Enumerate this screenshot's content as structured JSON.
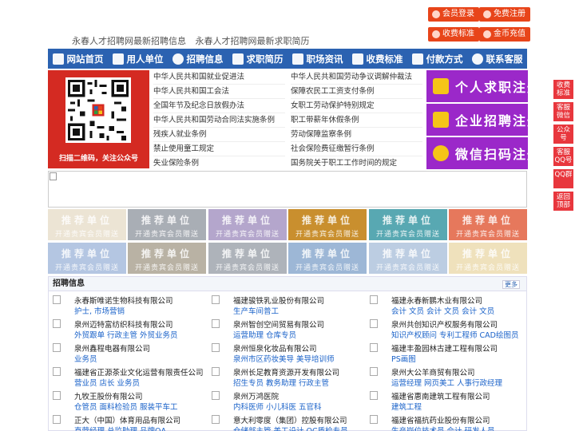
{
  "top_buttons": {
    "member_login": "会员登录",
    "free_register": "免费注册",
    "fee_standard": "收费标准",
    "coin_recharge": "金币充值"
  },
  "subtitle": {
    "item1": "永春人才招聘网最新招聘信息",
    "item2": "永春人才招聘网最新求职简历"
  },
  "nav": {
    "items": [
      {
        "label": "网站首页",
        "icon": "home-icon"
      },
      {
        "label": "用人单位",
        "icon": "building-icon"
      },
      {
        "label": "招聘信息",
        "icon": "chat-icon"
      },
      {
        "label": "求职简历",
        "icon": "id-card-icon"
      },
      {
        "label": "职场资讯",
        "icon": "news-icon"
      },
      {
        "label": "收费标准",
        "icon": "coin-icon"
      },
      {
        "label": "付款方式",
        "icon": "card-icon"
      },
      {
        "label": "联系客服",
        "icon": "phone-icon"
      }
    ]
  },
  "qr": {
    "caption": "扫描二维码，关注公众号"
  },
  "laws": {
    "left": [
      "中华人民共和国就业促进法",
      "中华人民共和国工会法",
      "全国年节及纪念日放假办法",
      "中华人民共和国劳动合同法实施条例",
      "残疾人就业条例",
      "禁止使用童工规定",
      "失业保险条例"
    ],
    "right": [
      "中华人民共和国劳动争议调解仲裁法",
      "保障农民工工资支付条例",
      "女职工劳动保护特别规定",
      "职工带薪年休假条例",
      "劳动保障监察条例",
      "社会保险费征缴暂行条例",
      "国务院关于职工工作时间的规定"
    ]
  },
  "register": {
    "personal": "个人求职注册",
    "company": "企业招聘注册",
    "wechat": "微信扫码注册"
  },
  "recommend": {
    "title": "推荐单位",
    "sub": "开通贵宾会员赠送",
    "colors": [
      "#ece4d4",
      "#a9aeb5",
      "#b4a6cc",
      "#c98f2e",
      "#58a8b2",
      "#e6785c",
      "#b4c6e2",
      "#b9b2a4",
      "#aeb3ba",
      "#9db7d6",
      "#bccde2",
      "#efe1bc"
    ]
  },
  "jobs": {
    "heading": "招聘信息",
    "more": "更多",
    "columns": [
      [
        {
          "company": "永春斯唯诺生物科技有限公司",
          "positions": "护士, 市场营销"
        },
        {
          "company": "泉州迈特富纺织科技有限公司",
          "positions": "外贸跟单 行政主管 外贸业务员"
        },
        {
          "company": "泉州鑫程电器有限公司",
          "positions": "业务员"
        },
        {
          "company": "福建省正源茶业文化运营有限责任公司",
          "positions": "营业员 店长 业务员"
        },
        {
          "company": "九牧王股份有限公司",
          "positions": "仓管员 面料检验员 服装平车工"
        },
        {
          "company": "正大（中国）体育用品有限公司",
          "positions": "直营经理 总监助理 品牌QA"
        }
      ],
      [
        {
          "company": "福建骏铁乳业股份有限公司",
          "positions": "生产车间普工"
        },
        {
          "company": "泉州智创空间贸易有限公司",
          "positions": "运营助理 仓库专员"
        },
        {
          "company": "泉州恒泉化妆品有限公司",
          "positions": "泉州市区药妆美导 美导培训师"
        },
        {
          "company": "泉州长足教育资源开发有限公司",
          "positions": "招生专员 教务助理 行政主管"
        },
        {
          "company": "泉州万鸿医院",
          "positions": "内科医师 小儿科医 五官科"
        },
        {
          "company": "意大利零度（集团）控股有限公司",
          "positions": "仓储部主管 美工设计 QC质检专员"
        }
      ],
      [
        {
          "company": "福建永春新鹏木业有限公司",
          "positions": "会计 文员 会计 文员 会计 文员"
        },
        {
          "company": "泉州共创知识产权服务有限公司",
          "positions": "知识产权顾问 专利工程师 CAD绘图员"
        },
        {
          "company": "福建丰盈园林古建工程有限公司",
          "positions": "PS画图"
        },
        {
          "company": "泉州大公羊商贸有限公司",
          "positions": "运营经理 网页美工 人事行政经理"
        },
        {
          "company": "福建省惠南建筑工程有限公司",
          "positions": "建筑工程"
        },
        {
          "company": "福建省福抗药业股份有限公司",
          "positions": "生产岗位技术员 会计 研发人员"
        }
      ]
    ]
  },
  "side_float": {
    "items": [
      "收费标准",
      "客服微信",
      "公众号",
      "客服QQ号",
      "QQ群",
      "返回顶部"
    ]
  }
}
